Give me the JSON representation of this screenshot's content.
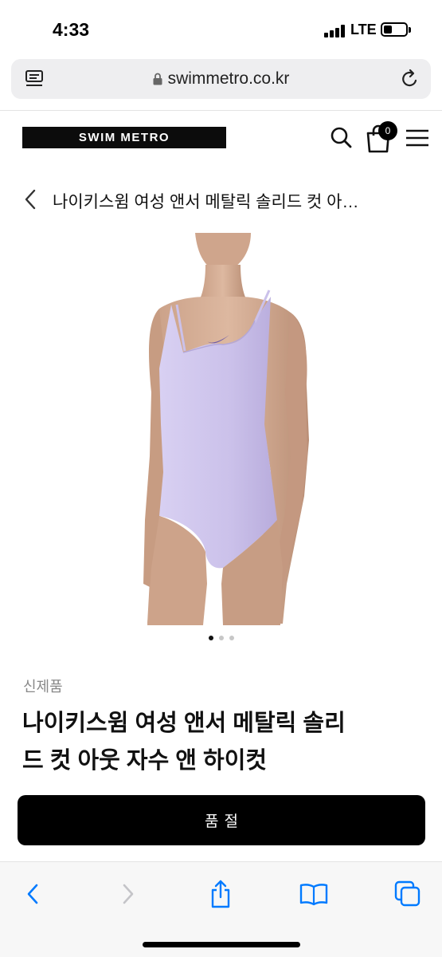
{
  "status_bar": {
    "time": "4:33",
    "network": "LTE",
    "battery_level": 0.4
  },
  "browser": {
    "url": "swimmetro.co.kr"
  },
  "site": {
    "logo": "SWIM METRO",
    "cart_count": "0"
  },
  "breadcrumb": {
    "title": "나이키스윔 여성 앤서 메탈릭 솔리드 컷 아…"
  },
  "gallery": {
    "dot_count": 3,
    "active_index": 0,
    "swimsuit_color": "#cdc3ec"
  },
  "product": {
    "condition": "신제품",
    "name_line1": "나이키스윔 여성 앤서 메탈릭 솔리",
    "name_line2": "드 컷 아웃 자수 앤 하이컷"
  },
  "buy_button": {
    "label": "품절"
  },
  "colors": {
    "accent": "#007aff",
    "button_bg": "#000000"
  }
}
